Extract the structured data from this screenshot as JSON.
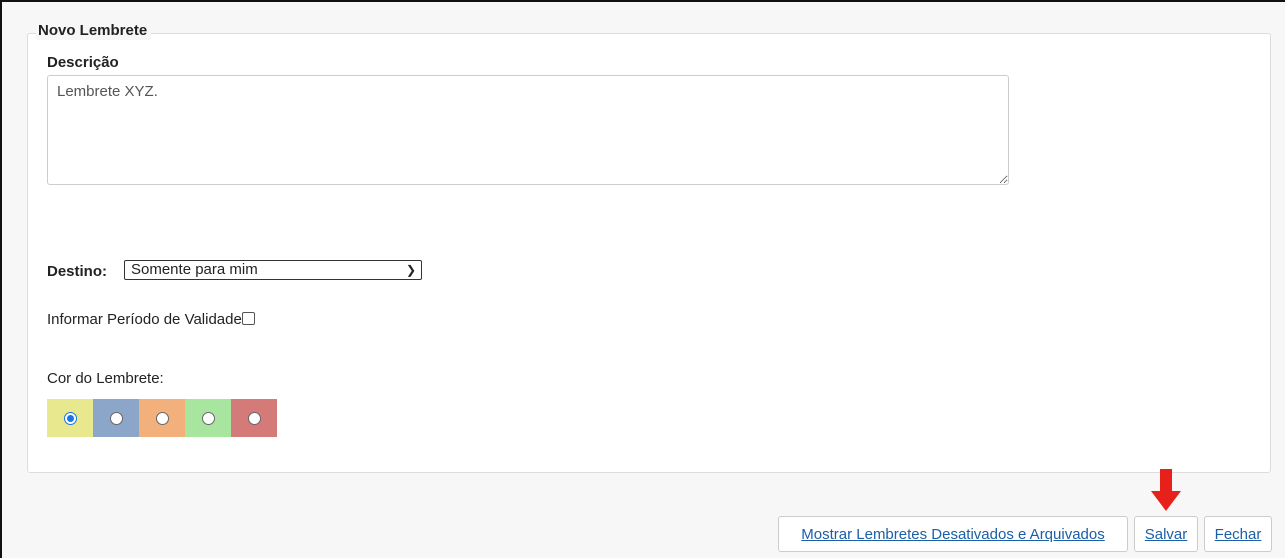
{
  "panel": {
    "legend": "Novo Lembrete"
  },
  "description": {
    "label": "Descrição",
    "value": "Lembrete XYZ."
  },
  "destination": {
    "label": "Destino:",
    "selected": "Somente para mim"
  },
  "validity": {
    "label": "Informar Período de Validade",
    "checked": false
  },
  "color": {
    "label": "Cor do Lembrete:",
    "options": [
      {
        "hex": "#e8e88e",
        "checked": true
      },
      {
        "hex": "#8ca6c9",
        "checked": false
      },
      {
        "hex": "#f2b07d",
        "checked": false
      },
      {
        "hex": "#a8e6a0",
        "checked": false
      },
      {
        "hex": "#d47a78",
        "checked": false
      }
    ]
  },
  "buttons": {
    "show_archived": "Mostrar Lembretes Desativados e Arquivados",
    "save": "Salvar",
    "close": "Fechar"
  },
  "annotation": {
    "arrow_color": "#e8201a"
  }
}
